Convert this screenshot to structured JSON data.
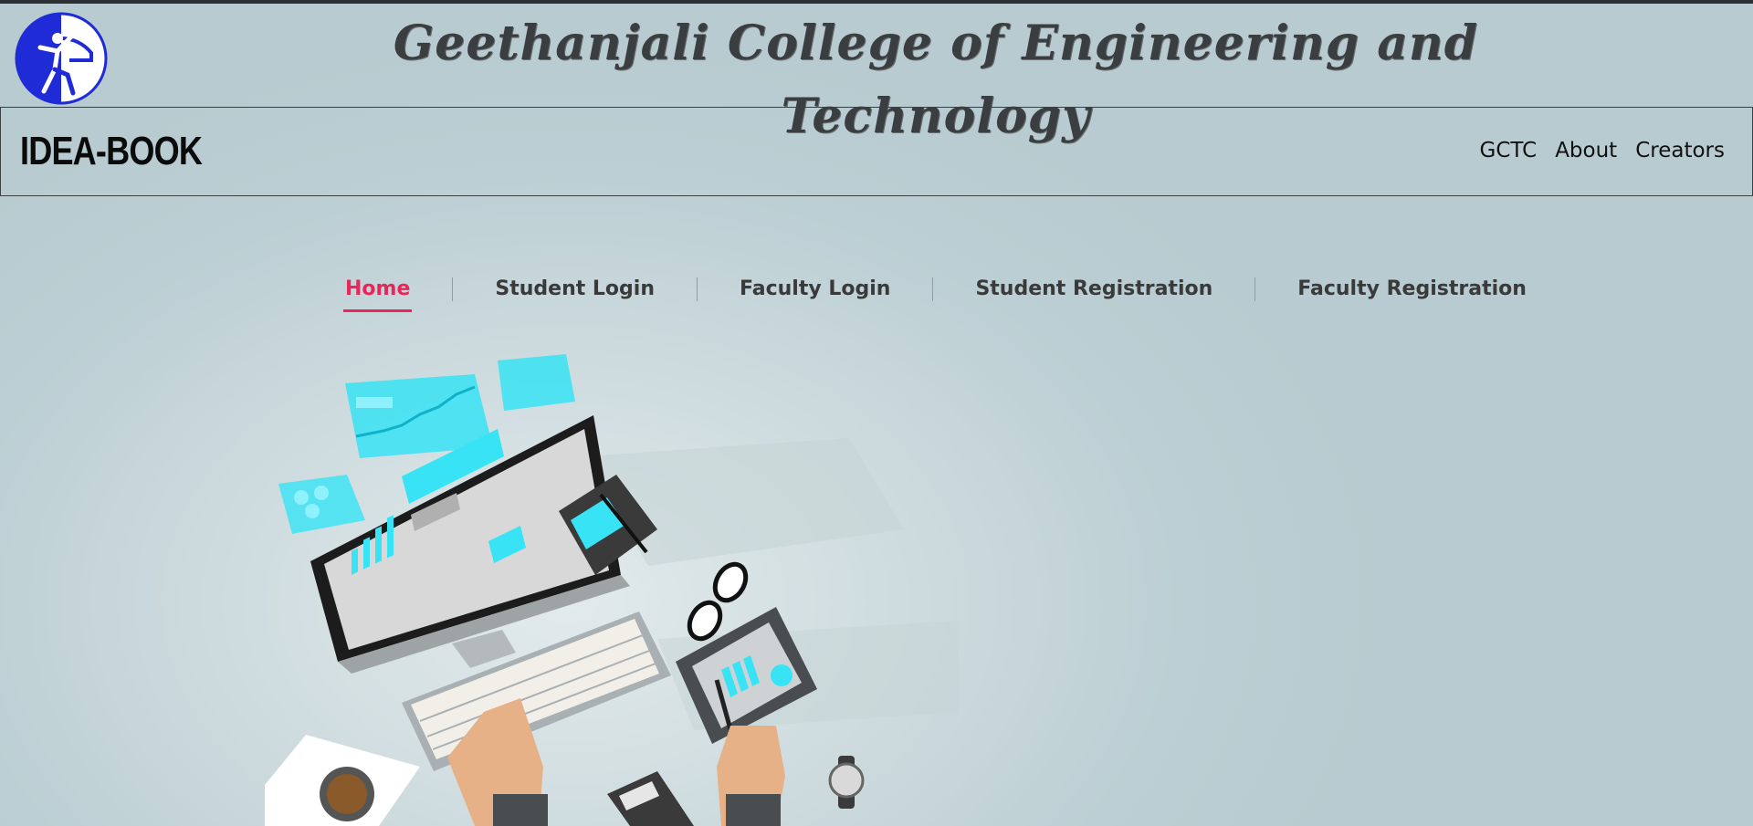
{
  "header": {
    "college_name": "Geethanjali College of Engineering and Technology",
    "logo_icon": "gcet-logo-icon"
  },
  "navbar": {
    "brand": "IDEA-BOOK",
    "links": [
      "GCTC",
      "About",
      "Creators"
    ]
  },
  "tabs": {
    "items": [
      "Home",
      "Student Login",
      "Faculty Login",
      "Student Registration",
      "Faculty Registration"
    ],
    "active": "Home"
  },
  "hero": {
    "illustration": "workspace-desk-illustration"
  },
  "colors": {
    "accent": "#e8265a",
    "background": "#b7cbd0",
    "logo_blue": "#1f2bd6",
    "cyan": "#37e3f5"
  }
}
